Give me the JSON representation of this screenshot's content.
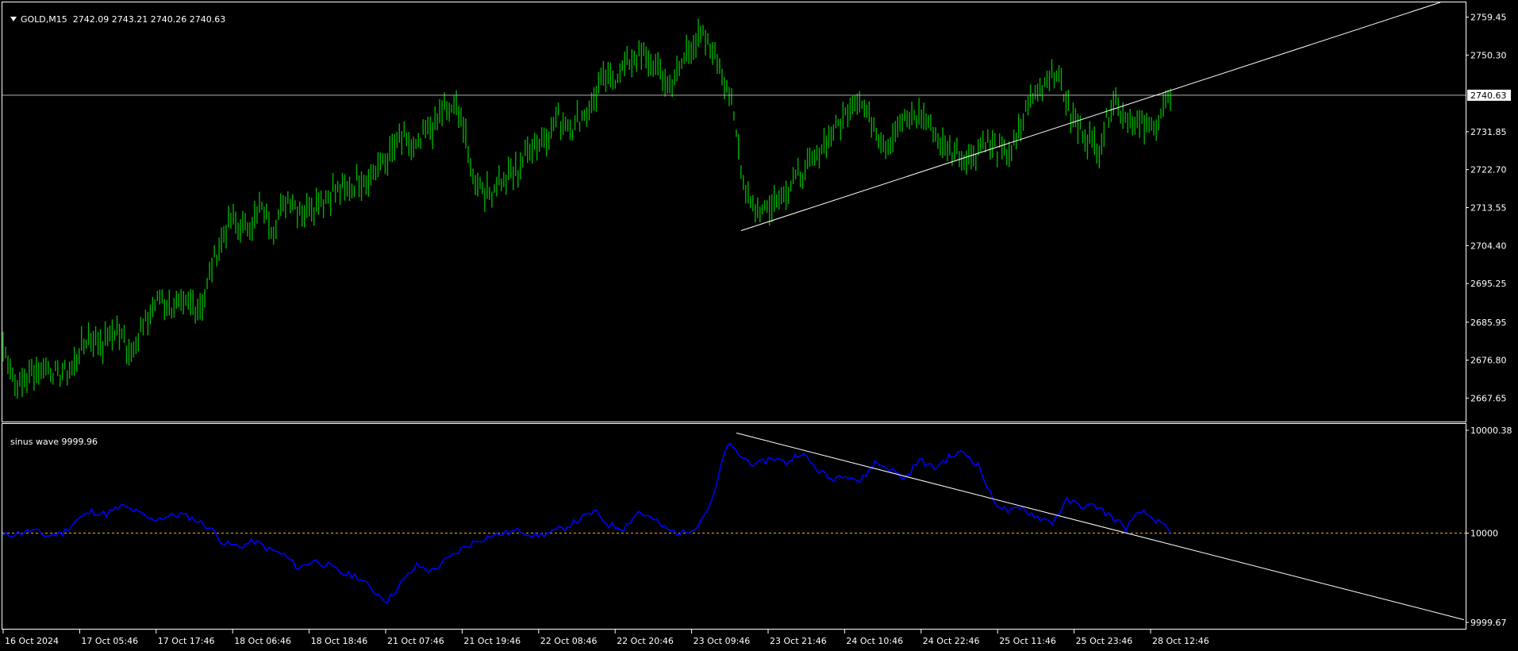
{
  "main_pane": {
    "symbol": "GOLD,M15",
    "ohlc": "2742.09 2743.21 2740.26 2740.63",
    "current_price_label": "2740.63"
  },
  "indicator_pane": {
    "name": "sinus wave",
    "value": "9999.96",
    "level_label": "10000"
  },
  "colors": {
    "background": "#000000",
    "frame": "#ffffff",
    "candles": "#00b000",
    "indicator_line": "#0000ff",
    "level_line": "#ffa500",
    "trendline": "#ffffff"
  },
  "chart_data": [
    {
      "type": "line",
      "title": "GOLD,M15",
      "subtitle": "2742.09 2743.21 2740.26 2740.63",
      "ylim": [
        2662,
        2763
      ],
      "y_ticks": [
        "2759.45",
        "2750.30",
        "2740.63",
        "2731.85",
        "2722.70",
        "2713.55",
        "2704.40",
        "2695.25",
        "2685.95",
        "2676.80",
        "2667.65"
      ],
      "x_ticks": [
        "16 Oct 2024",
        "17 Oct 05:46",
        "17 Oct 17:46",
        "18 Oct 06:46",
        "18 Oct 18:46",
        "21 Oct 07:46",
        "21 Oct 19:46",
        "22 Oct 08:46",
        "22 Oct 20:46",
        "23 Oct 09:46",
        "23 Oct 21:46",
        "24 Oct 10:46",
        "24 Oct 22:46",
        "25 Oct 11:46",
        "25 Oct 23:46",
        "28 Oct 12:46"
      ],
      "series": [
        {
          "values": [
            2680,
            2670,
            2674,
            2675,
            2673,
            2676,
            2683,
            2681,
            2684,
            2679,
            2686,
            2692,
            2689,
            2690,
            2691,
            2703,
            2710,
            2708,
            2713,
            2709,
            2716,
            2713,
            2715,
            2717,
            2718,
            2720,
            2722,
            2726,
            2730,
            2728,
            2732,
            2737,
            2738,
            2721,
            2717,
            2720,
            2722,
            2728,
            2730,
            2735,
            2733,
            2737,
            2743,
            2745,
            2749,
            2750,
            2746,
            2743,
            2751,
            2755,
            2751,
            2742,
            2720,
            2712,
            2715,
            2718,
            2721,
            2725,
            2731,
            2735,
            2740,
            2735,
            2728,
            2734,
            2736,
            2734,
            2728,
            2727,
            2725,
            2730,
            2727,
            2728,
            2738,
            2743,
            2747,
            2735,
            2731,
            2728,
            2740,
            2735,
            2733,
            2734,
            2740
          ]
        }
      ],
      "price_level": 2740.63,
      "trendline": {
        "from": [
          "23 Oct 09:46",
          2708
        ],
        "to": [
          "28 Oct 12:46+",
          2763
        ]
      }
    },
    {
      "type": "line",
      "title": "sinus wave",
      "subtitle": "9999.96",
      "ylim": [
        9999.67,
        10000.38
      ],
      "y_ticks": [
        "10000.38",
        "10000",
        "9999.67"
      ],
      "level": 10000,
      "series": [
        {
          "values": [
            9999.99,
            10000.0,
            10000.01,
            9999.99,
            10000.0,
            10000.05,
            10000.08,
            10000.07,
            10000.1,
            10000.08,
            10000.05,
            10000.06,
            10000.07,
            10000.05,
            10000.02,
            9999.96,
            9999.95,
            9999.97,
            9999.94,
            9999.92,
            9999.87,
            9999.9,
            9999.88,
            9999.85,
            9999.84,
            9999.79,
            9999.75,
            9999.82,
            9999.88,
            9999.86,
            9999.9,
            9999.94,
            9999.97,
            9999.99,
            10000.0,
            10000.01,
            9999.99,
            10000.0,
            10000.02,
            10000.05,
            10000.08,
            10000.03,
            10000.02,
            10000.08,
            10000.05,
            10000.01,
            10000.0,
            10000.03,
            10000.12,
            10000.33,
            10000.28,
            10000.25,
            10000.28,
            10000.26,
            10000.3,
            10000.24,
            10000.2,
            10000.22,
            10000.19,
            10000.26,
            10000.24,
            10000.2,
            10000.27,
            10000.24,
            10000.28,
            10000.3,
            10000.25,
            10000.12,
            10000.08,
            10000.09,
            10000.06,
            10000.04,
            10000.12,
            10000.1,
            10000.1,
            10000.06,
            10000.02,
            10000.08,
            10000.05,
            10000.0
          ]
        }
      ],
      "trendline": {
        "from": [
          "23 Oct 09:46",
          10000.37
        ],
        "to": [
          "28 Oct 12:46+",
          9999.68
        ]
      }
    }
  ]
}
